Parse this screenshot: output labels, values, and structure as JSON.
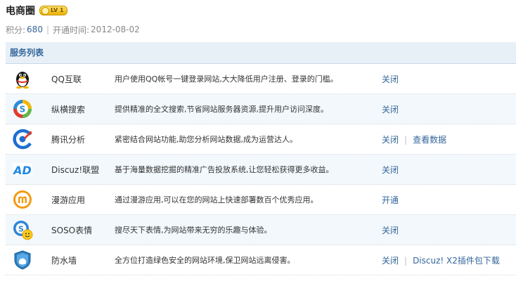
{
  "header": {
    "title": "电商圈",
    "level_badge": "LV 1",
    "score_label": "积分:",
    "score_value": "680",
    "separator": "|",
    "open_time_label": "开通时间:",
    "open_time_value": "2012-08-02"
  },
  "services": {
    "heading": "服务列表",
    "rows": [
      {
        "icon": "qq-penguin-icon",
        "name": "QQ互联",
        "desc": "用户使用QQ帐号一键登录网站,大大降低用户注册、登录的门槛。",
        "actions": [
          "关闭"
        ]
      },
      {
        "icon": "soso-search-icon",
        "name": "纵横搜索",
        "desc": "提供精准的全文搜索,节省网站服务器资源,提升用户访问深度。",
        "actions": [
          "关闭"
        ]
      },
      {
        "icon": "tencent-analytics-icon",
        "name": "腾讯分析",
        "desc": "紧密结合网站功能,助您分析网站数据,成为运营达人。",
        "actions": [
          "关闭",
          "查看数据"
        ]
      },
      {
        "icon": "discuz-ad-icon",
        "name": "Discuz!联盟",
        "desc": "基于海量数据挖掘的精准广告投放系统,让您轻松获得更多收益。",
        "actions": [
          "关闭"
        ]
      },
      {
        "icon": "manyou-icon",
        "name": "漫游应用",
        "desc": "通过漫游应用,可以在您的网站上快速部署数百个优秀应用。",
        "actions": [
          "开通"
        ]
      },
      {
        "icon": "soso-emoji-icon",
        "name": "SOSO表情",
        "desc": "搜尽天下表情,为网站带来无穷的乐趣与体验。",
        "actions": [
          "关闭"
        ]
      },
      {
        "icon": "firewall-shield-icon",
        "name": "防水墙",
        "desc": "全方位打造绿色安全的网站环境,保卫网站远离侵害。",
        "actions": [
          "关闭",
          "Discuz! X2插件包下载"
        ]
      }
    ]
  }
}
